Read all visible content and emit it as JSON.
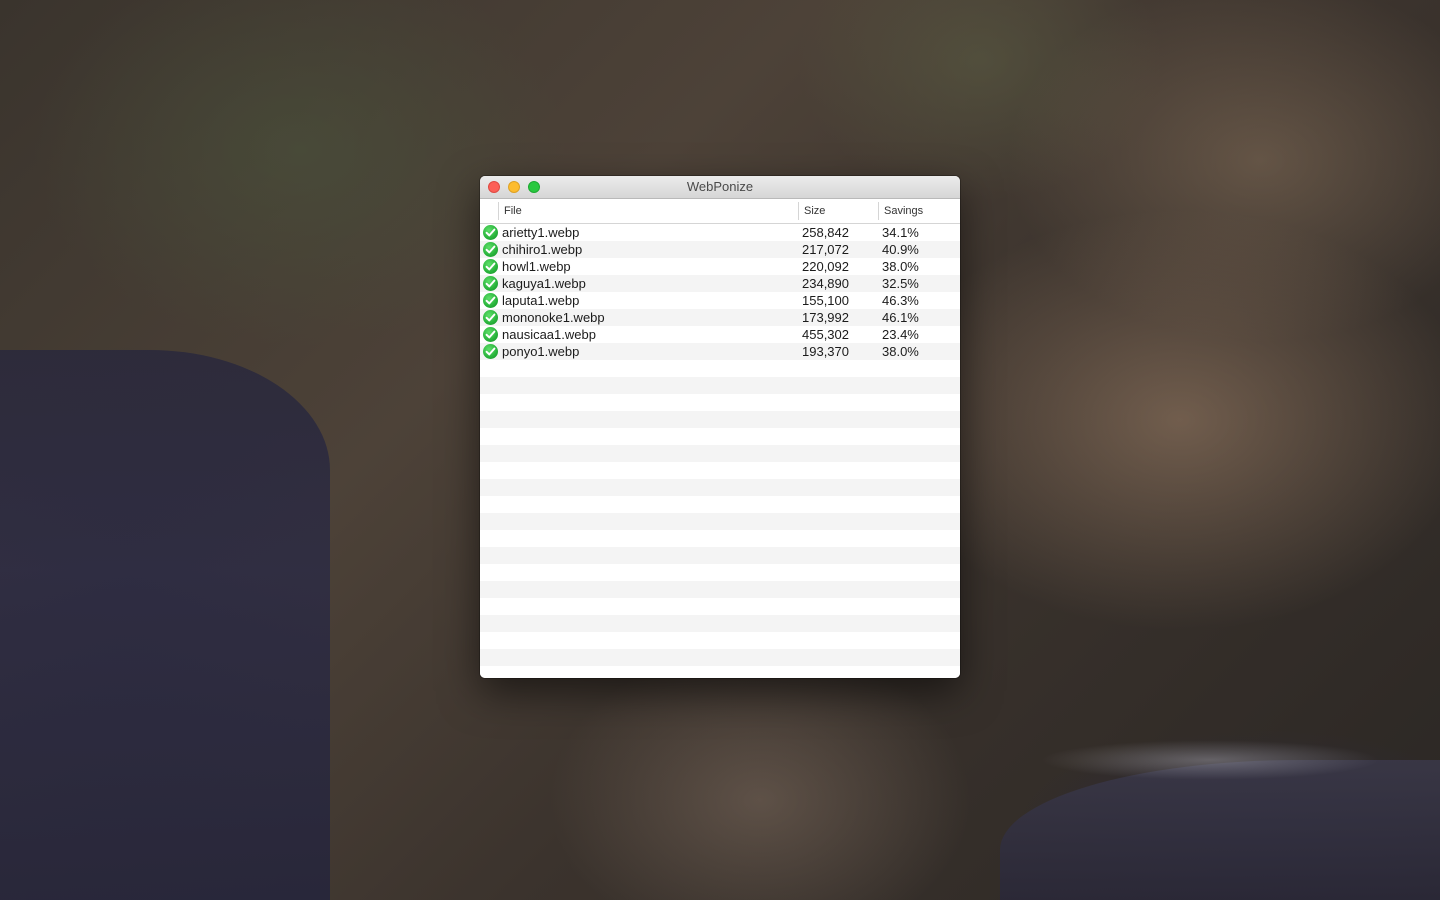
{
  "window": {
    "title": "WebPonize"
  },
  "table": {
    "columns": {
      "file": "File",
      "size": "Size",
      "savings": "Savings"
    },
    "rows": [
      {
        "file": "arietty1.webp",
        "size": "258,842",
        "savings": "34.1%",
        "status_icon": "check-circle-icon"
      },
      {
        "file": "chihiro1.webp",
        "size": "217,072",
        "savings": "40.9%",
        "status_icon": "check-circle-icon"
      },
      {
        "file": "howl1.webp",
        "size": "220,092",
        "savings": "38.0%",
        "status_icon": "check-circle-icon"
      },
      {
        "file": "kaguya1.webp",
        "size": "234,890",
        "savings": "32.5%",
        "status_icon": "check-circle-icon"
      },
      {
        "file": "laputa1.webp",
        "size": "155,100",
        "savings": "46.3%",
        "status_icon": "check-circle-icon"
      },
      {
        "file": "mononoke1.webp",
        "size": "173,992",
        "savings": "46.1%",
        "status_icon": "check-circle-icon"
      },
      {
        "file": "nausicaa1.webp",
        "size": "455,302",
        "savings": "23.4%",
        "status_icon": "check-circle-icon"
      },
      {
        "file": "ponyo1.webp",
        "size": "193,370",
        "savings": "38.0%",
        "status_icon": "check-circle-icon"
      }
    ]
  },
  "colors": {
    "traffic_close": "#fc5f57",
    "traffic_minimize": "#fdbc2e",
    "traffic_zoom": "#29c83f",
    "status_success": "#27b23a"
  }
}
